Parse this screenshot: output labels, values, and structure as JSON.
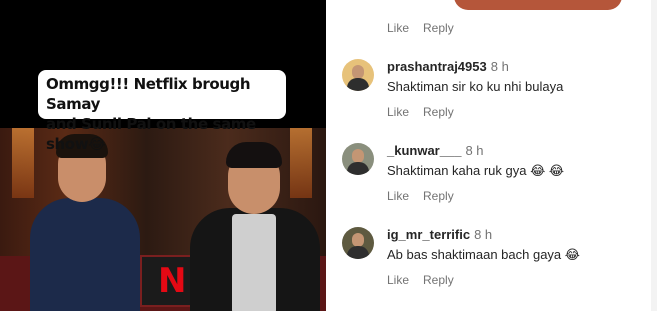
{
  "video": {
    "caption_line1": "Ommgg!!! Netflix brough Samay",
    "caption_line2": "and Sunil Pal on the same show😂",
    "pillow_mark": "N"
  },
  "actions": {
    "like": "Like",
    "reply": "Reply"
  },
  "comments": [
    {
      "username": "prashantraj4953",
      "time": "8 h",
      "text": "Shaktiman sir ko ku nhi bulaya",
      "avatar_bg": "#e7c27a"
    },
    {
      "username": "_kunwar___",
      "time": "8 h",
      "text": "Shaktiman kaha ruk gya 😂 😂",
      "avatar_bg": "#8a8f7d"
    },
    {
      "username": "ig_mr_terrific",
      "time": "8 h",
      "text": "Ab bas shaktimaan bach gaya 😂",
      "avatar_bg": "#5e5a40"
    }
  ]
}
